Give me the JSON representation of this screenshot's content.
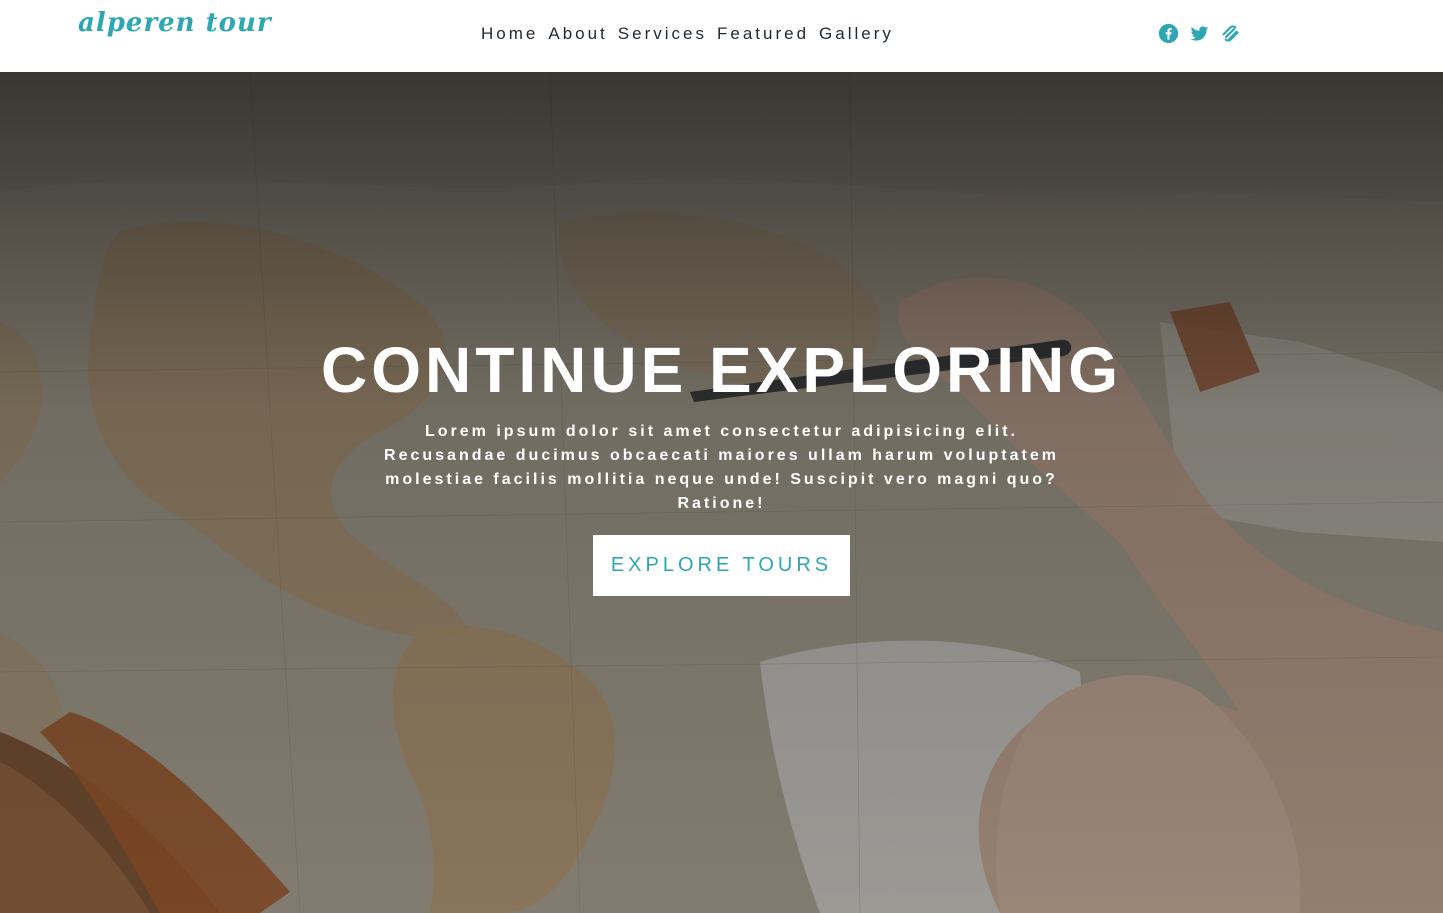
{
  "brand": {
    "logo": "alperen tour",
    "accent": "#2ea7b3"
  },
  "nav": {
    "links": [
      "Home",
      "About",
      "Services",
      "Featured",
      "Gallery"
    ]
  },
  "social": [
    "facebook-icon",
    "twitter-icon",
    "squarespace-icon"
  ],
  "hero": {
    "title": "CONTINUE EXPLORING",
    "text": "Lorem ipsum dolor sit amet consectetur adipisicing elit. Recusandae ducimus obcaecati maiores ullam harum voluptatem molestiae facilis mollitia neque unde! Suscipit vero magni quo? Ratione!",
    "button": "EXPLORE TOURS",
    "background": "map-with-hands-photo"
  }
}
